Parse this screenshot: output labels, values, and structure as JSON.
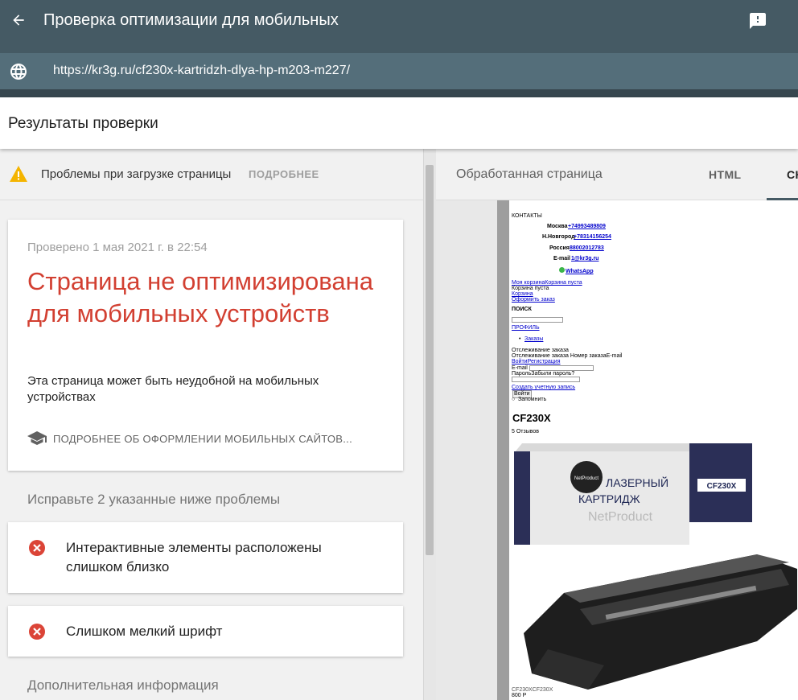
{
  "appbar": {
    "title": "Проверка оптимизации для мобильных"
  },
  "urlbar": {
    "url": "https://kr3g.ru/cf230x-kartridzh-dlya-hp-m203-m227/"
  },
  "results": {
    "header": "Результаты проверки"
  },
  "warning": {
    "text": "Проблемы при загрузке страницы",
    "link": "ПОДРОБНЕЕ"
  },
  "summary": {
    "checked": "Проверено 1 мая 2021 г. в 22:54",
    "verdict": "Страница не оптимизирована для мобильных устройств",
    "description": "Эта страница может быть неудобной на мобильных устройствах",
    "learn_more": "ПОДРОБНЕЕ ОБ ОФОРМЛЕНИИ МОБИЛЬНЫХ САЙТОВ..."
  },
  "issues": {
    "title": "Исправьте 2 указанные ниже проблемы",
    "items": [
      {
        "label": "Интерактивные элементы расположены слишком близко"
      },
      {
        "label": "Слишком мелкий шрифт"
      }
    ]
  },
  "extra": {
    "title": "Дополнительная информация"
  },
  "tabs": {
    "rendered": "Обработанная страница",
    "html": "HTML",
    "screenshot": "СКРИНШОТ",
    "screenshot_visible": "СК"
  },
  "preview": {
    "contacts": "КОНТАКТЫ",
    "moscow_label": "Москва",
    "moscow_phone": "+74993489809",
    "nn_label": "Н.Новгород",
    "nn_phone": "+78314156254",
    "russia_label": "Россия",
    "russia_phone": "88002012783",
    "email_label": "E-mail",
    "email": "1@kr3g.ru",
    "whatsapp": "WhatsApp",
    "cart_link": "Моя корзинаКорзина пуста",
    "cart_empty": "Корзина пуста",
    "cart": "Корзина",
    "checkout": "Оформить заказ",
    "search": "ПОИСК",
    "profile": "ПРОФИЛЬ",
    "orders": "Заказы",
    "tracking": "Отслеживание заказа",
    "tracking_line": "Отслеживание заказа Номер заказаE-mail",
    "login_reg": "ВойтиРегистрация",
    "email_field": "E-mail",
    "password_line": "ПарольЗабыли пароль?",
    "create_account": "Создать учетную запись",
    "login_btn": "Войти",
    "remember": "Запомнить",
    "product_title": "CF230X",
    "reviews": "5 Отзывов",
    "box_brand": "NetProduct",
    "box_line1": "ЛАЗЕРНЫЙ",
    "box_line2": "КАРТРИДЖ",
    "box_brand_big": "NetProduct",
    "box_model": "CF230X",
    "bottom_alt": "CF230XCF230X",
    "bottom_price": "800 Р"
  },
  "colors": {
    "appbar": "#455a64",
    "urlbar": "#546e7a",
    "verdict_red": "#d23f31",
    "warning_yellow": "#f4b400",
    "error_red": "#db4437"
  }
}
